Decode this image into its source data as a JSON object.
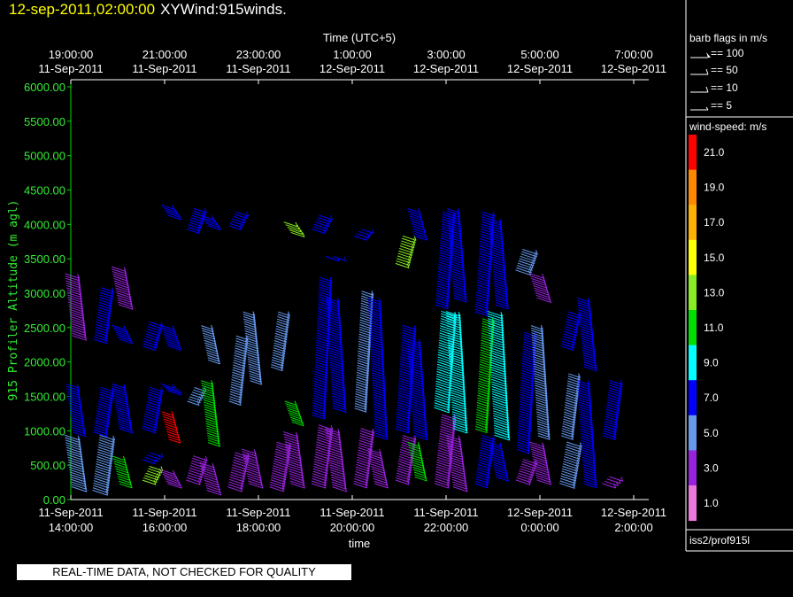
{
  "header": {
    "timestamp": "12-sep-2011,02:00:00",
    "name": "XYWind:915winds."
  },
  "chart_data": {
    "type": "wind-barb profile (time-height)",
    "top_axis_title": "Time (UTC+5)",
    "top_ticks": [
      {
        "time": "19:00:00",
        "date": "11-Sep-2011"
      },
      {
        "time": "21:00:00",
        "date": "11-Sep-2011"
      },
      {
        "time": "23:00:00",
        "date": "11-Sep-2011"
      },
      {
        "time": "1:00:00",
        "date": "12-Sep-2011"
      },
      {
        "time": "3:00:00",
        "date": "12-Sep-2011"
      },
      {
        "time": "5:00:00",
        "date": "12-Sep-2011"
      },
      {
        "time": "7:00:00",
        "date": "12-Sep-2011"
      }
    ],
    "bottom_ticks": [
      {
        "date": "11-Sep-2011",
        "time": "14:00:00"
      },
      {
        "date": "11-Sep-2011",
        "time": "16:00:00"
      },
      {
        "date": "11-Sep-2011",
        "time": "18:00:00"
      },
      {
        "date": "11-Sep-2011",
        "time": "20:00:00"
      },
      {
        "date": "11-Sep-2011",
        "time": "22:00:00"
      },
      {
        "date": "12-Sep-2011",
        "time": "0:00:00"
      },
      {
        "date": "12-Sep-2011",
        "time": "2:00:00"
      }
    ],
    "xlabel": "time",
    "ylabel": "915 Profiler Altitude (m agl)",
    "yticks": [
      "0.00",
      "500.00",
      "1000.00",
      "1500.00",
      "2000.00",
      "2500.00",
      "3000.00",
      "3500.00",
      "4000.00",
      "4500.00",
      "5000.00",
      "5500.00",
      "6000.00"
    ],
    "ylim": [
      0,
      6000
    ],
    "xlim_hours": [
      0,
      12.4
    ],
    "profiles": [
      {
        "t": 0.0,
        "segments": [
          [
            150,
            900,
            4
          ],
          [
            950,
            1650,
            6
          ],
          [
            2350,
            3250,
            3
          ]
        ]
      },
      {
        "t": 0.45,
        "segments": [
          [
            100,
            900,
            4
          ],
          [
            950,
            1600,
            7
          ],
          [
            2300,
            3050,
            6
          ]
        ]
      },
      {
        "t": 1.0,
        "segments": [
          [
            200,
            600,
            11
          ],
          [
            1000,
            1650,
            7
          ],
          [
            2300,
            2500,
            7
          ],
          [
            2800,
            3350,
            3
          ]
        ]
      },
      {
        "t": 1.5,
        "segments": [
          [
            250,
            450,
            12
          ],
          [
            550,
            650,
            7
          ],
          [
            1000,
            1600,
            7
          ],
          [
            2200,
            2550,
            7
          ]
        ]
      },
      {
        "t": 2.05,
        "segments": [
          [
            200,
            400,
            3
          ],
          [
            850,
            1250,
            20
          ],
          [
            1550,
            1650,
            7
          ],
          [
            2200,
            2500,
            7
          ],
          [
            4100,
            4250,
            6
          ]
        ]
      },
      {
        "t": 2.45,
        "segments": [
          [
            250,
            600,
            3
          ],
          [
            1400,
            1600,
            5
          ],
          [
            3900,
            4200,
            6
          ]
        ]
      },
      {
        "t": 2.9,
        "segments": [
          [
            100,
            500,
            3
          ],
          [
            800,
            1700,
            10
          ],
          [
            2000,
            2500,
            5
          ],
          [
            3950,
            4100,
            6
          ]
        ]
      },
      {
        "t": 3.35,
        "segments": [
          [
            150,
            650,
            3
          ],
          [
            1400,
            2350,
            5
          ],
          [
            3950,
            4150,
            6
          ]
        ]
      },
      {
        "t": 3.8,
        "segments": [
          [
            200,
            700,
            3
          ],
          [
            1700,
            2700,
            5
          ]
        ]
      },
      {
        "t": 4.25,
        "segments": [
          [
            150,
            800,
            3
          ],
          [
            1900,
            2700,
            5
          ]
        ]
      },
      {
        "t": 4.7,
        "segments": [
          [
            200,
            950,
            3
          ],
          [
            1100,
            1400,
            10
          ],
          [
            3850,
            4000,
            12
          ]
        ]
      },
      {
        "t": 5.15,
        "segments": [
          [
            200,
            1050,
            3
          ],
          [
            1200,
            3200,
            6
          ],
          [
            3900,
            4100,
            7
          ]
        ]
      },
      {
        "t": 5.6,
        "segments": [
          [
            150,
            1000,
            3
          ],
          [
            1300,
            2900,
            7
          ],
          [
            3500,
            3500,
            7
          ]
        ]
      },
      {
        "t": 6.05,
        "segments": [
          [
            200,
            1000,
            2
          ],
          [
            1300,
            3000,
            5
          ],
          [
            3800,
            3900,
            6
          ]
        ]
      },
      {
        "t": 6.5,
        "segments": [
          [
            200,
            700,
            2
          ],
          [
            900,
            2900,
            6
          ]
        ]
      },
      {
        "t": 6.95,
        "segments": [
          [
            250,
            900,
            2
          ],
          [
            1000,
            2500,
            7
          ],
          [
            3400,
            3800,
            12
          ]
        ]
      },
      {
        "t": 7.35,
        "segments": [
          [
            300,
            800,
            10
          ],
          [
            900,
            2300,
            7
          ],
          [
            3800,
            4200,
            6
          ]
        ]
      },
      {
        "t": 7.8,
        "segments": [
          [
            200,
            1200,
            3
          ],
          [
            1300,
            2700,
            9
          ],
          [
            2800,
            4150,
            6
          ]
        ]
      },
      {
        "t": 8.2,
        "segments": [
          [
            150,
            900,
            3
          ],
          [
            1000,
            2700,
            8
          ],
          [
            2900,
            4200,
            6
          ]
        ]
      },
      {
        "t": 8.65,
        "segments": [
          [
            200,
            900,
            6
          ],
          [
            1000,
            2600,
            10
          ],
          [
            2700,
            4150,
            6
          ]
        ]
      },
      {
        "t": 9.1,
        "segments": [
          [
            300,
            800,
            6
          ],
          [
            900,
            2700,
            9
          ],
          [
            2800,
            4050,
            6
          ]
        ]
      },
      {
        "t": 9.55,
        "segments": [
          [
            250,
            550,
            3
          ],
          [
            700,
            2400,
            6
          ],
          [
            3300,
            3600,
            4
          ]
        ]
      },
      {
        "t": 10.0,
        "segments": [
          [
            250,
            800,
            3
          ],
          [
            900,
            2500,
            5
          ],
          [
            2900,
            3250,
            3
          ]
        ]
      },
      {
        "t": 10.5,
        "segments": [
          [
            200,
            800,
            4
          ],
          [
            900,
            1800,
            5
          ],
          [
            2200,
            2700,
            6
          ]
        ]
      },
      {
        "t": 11.0,
        "segments": [
          [
            200,
            1700,
            6
          ],
          [
            1900,
            2900,
            6
          ]
        ]
      },
      {
        "t": 11.4,
        "segments": [
          [
            200,
            300,
            2
          ],
          [
            900,
            1700,
            6
          ]
        ]
      }
    ],
    "barb_flags": {
      "title": "barb flags in m/s",
      "items": [
        "== 100",
        "== 50",
        "== 10",
        "== 5"
      ]
    },
    "wind_speed_legend": {
      "title": "wind-speed: m/s",
      "items": [
        {
          "label": "21.0",
          "color": "#ff0000"
        },
        {
          "label": "19.0",
          "color": "#ff8800"
        },
        {
          "label": "17.0",
          "color": "#ffb000"
        },
        {
          "label": "15.0",
          "color": "#ffff00"
        },
        {
          "label": "13.0",
          "color": "#88ee22"
        },
        {
          "label": "11.0",
          "color": "#00dd00"
        },
        {
          "label": "9.0",
          "color": "#00ffff"
        },
        {
          "label": "7.0",
          "color": "#0000ff"
        },
        {
          "label": "5.0",
          "color": "#6699ee"
        },
        {
          "label": "3.0",
          "color": "#9922dd"
        },
        {
          "label": "1.0",
          "color": "#ee77dd"
        }
      ]
    },
    "source": "iss2/prof915l"
  },
  "disclaimer": "REAL-TIME DATA, NOT CHECKED FOR QUALITY"
}
